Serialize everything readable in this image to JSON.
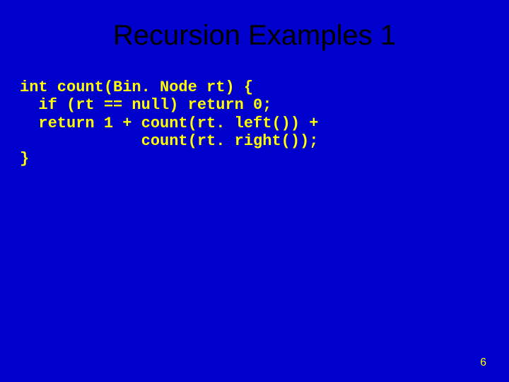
{
  "slide": {
    "title": "Recursion Examples 1",
    "code": "int count(Bin. Node rt) {\n  if (rt == null) return 0;\n  return 1 + count(rt. left()) +\n             count(rt. right());\n}",
    "pageNumber": "6"
  }
}
